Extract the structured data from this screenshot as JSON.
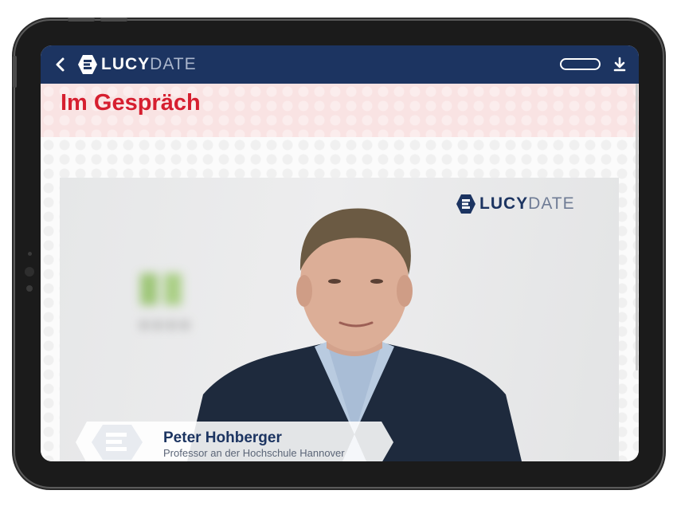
{
  "app": {
    "brand_primary": "LUCY",
    "brand_secondary": "DATE",
    "brand_color": "#1c3461",
    "accent_color": "#d61f30",
    "icons": {
      "back": "chevron-left-icon",
      "menu": "pill-menu-icon",
      "download": "download-icon",
      "logo": "lucydate-logo-icon"
    }
  },
  "page": {
    "title": "Im Gespräch"
  },
  "video": {
    "watermark_primary": "LUCY",
    "watermark_secondary": "DATE",
    "speaker_name": "Peter Hohberger",
    "speaker_role": "Professor an der Hochschule Hannover"
  }
}
